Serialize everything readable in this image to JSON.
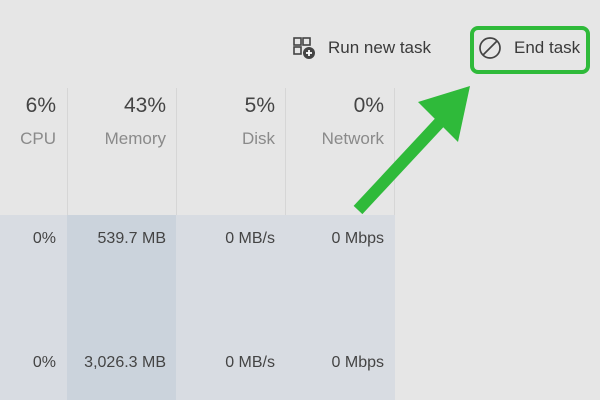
{
  "toolbar": {
    "run_new_task_label": "Run new task",
    "end_task_label": "End task",
    "run_icon": "run-task-icon",
    "end_icon": "no-entry-icon"
  },
  "header": {
    "cpu": {
      "percent": "6%",
      "label": "CPU"
    },
    "memory": {
      "percent": "43%",
      "label": "Memory"
    },
    "disk": {
      "percent": "5%",
      "label": "Disk"
    },
    "network": {
      "percent": "0%",
      "label": "Network"
    }
  },
  "rows": [
    {
      "cpu": "0%",
      "memory": "539.7 MB",
      "disk": "0 MB/s",
      "network": "0 Mbps"
    },
    {
      "cpu": "0%",
      "memory": "3,026.3 MB",
      "disk": "0 MB/s",
      "network": "0 Mbps"
    }
  ],
  "colors": {
    "highlight": "#2fba3a",
    "arrow": "#2fba3a"
  }
}
